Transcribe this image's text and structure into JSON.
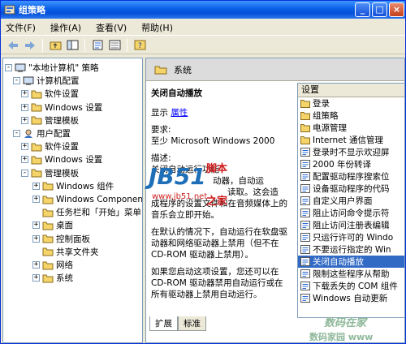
{
  "title": "组策略",
  "menu": [
    "文件(F)",
    "操作(A)",
    "查看(V)",
    "帮助(H)"
  ],
  "tree": [
    {
      "label": "\"本地计算机\" 策略",
      "level": 0,
      "pm": "-",
      "icon": "computer"
    },
    {
      "label": "计算机配置",
      "level": 1,
      "pm": "-",
      "icon": "computer"
    },
    {
      "label": "软件设置",
      "level": 2,
      "pm": "+",
      "icon": "folder"
    },
    {
      "label": "Windows 设置",
      "level": 2,
      "pm": "+",
      "icon": "folder"
    },
    {
      "label": "管理模板",
      "level": 2,
      "pm": "+",
      "icon": "folder"
    },
    {
      "label": "用户配置",
      "level": 1,
      "pm": "-",
      "icon": "user"
    },
    {
      "label": "软件设置",
      "level": 2,
      "pm": "+",
      "icon": "folder"
    },
    {
      "label": "Windows 设置",
      "level": 2,
      "pm": "+",
      "icon": "folder"
    },
    {
      "label": "管理模板",
      "level": 2,
      "pm": "-",
      "icon": "folder"
    },
    {
      "label": "Windows 组件",
      "level": 3,
      "pm": "+",
      "icon": "folder"
    },
    {
      "label": "Windows Components",
      "level": 3,
      "pm": "+",
      "icon": "folder"
    },
    {
      "label": "任务栏和「开始」菜单",
      "level": 3,
      "pm": "",
      "icon": "folder"
    },
    {
      "label": "桌面",
      "level": 3,
      "pm": "+",
      "icon": "folder"
    },
    {
      "label": "控制面板",
      "level": 3,
      "pm": "+",
      "icon": "folder"
    },
    {
      "label": "共享文件夹",
      "level": 3,
      "pm": "",
      "icon": "folder"
    },
    {
      "label": "网络",
      "level": 3,
      "pm": "+",
      "icon": "folder"
    },
    {
      "label": "系统",
      "level": 3,
      "pm": "+",
      "icon": "folder"
    }
  ],
  "right": {
    "header": "系统",
    "setting_title": "关闭自动播放",
    "display_label": "显示",
    "properties_link": "属性",
    "requirements_label": "要求:",
    "requirements": "至少 Microsoft Windows 2000",
    "desc_label": "描述:",
    "desc_lines": [
      "关闭自动运行功能",
      "动器，自动运",
      "读取。这会造",
      "成程序的设置文件和在音频媒体上的音乐会立即开始。"
    ],
    "para2": "在默认的情况下，自动运行在软盘驱动器和网络驱动器上禁用（但不在 CD-ROM 驱动器上禁用）。",
    "para3": "如果您启动这项设置，您还可以在 CD-ROM 驱动器禁用自动运行或在所有驱动器上禁用自动运行。"
  },
  "list": {
    "header": "设置",
    "items": [
      {
        "label": "登录",
        "icon": "folder"
      },
      {
        "label": "组策略",
        "icon": "folder"
      },
      {
        "label": "电源管理",
        "icon": "folder"
      },
      {
        "label": "Internet 通信管理",
        "icon": "folder"
      },
      {
        "label": "登录时不显示欢迎屏",
        "icon": "setting"
      },
      {
        "label": "2000 年份转译",
        "icon": "setting"
      },
      {
        "label": "配置驱动程序搜索位",
        "icon": "setting"
      },
      {
        "label": "设备驱动程序的代码",
        "icon": "setting"
      },
      {
        "label": "自定义用户界面",
        "icon": "setting"
      },
      {
        "label": "阻止访问命令提示符",
        "icon": "setting"
      },
      {
        "label": "阻止访问注册表编辑",
        "icon": "setting"
      },
      {
        "label": "只运行许可的 Windo",
        "icon": "setting"
      },
      {
        "label": "不要运行指定的 Win",
        "icon": "setting"
      },
      {
        "label": "关闭自动播放",
        "icon": "setting",
        "selected": true
      },
      {
        "label": "限制这些程序从帮助",
        "icon": "setting"
      },
      {
        "label": "下载丢失的 COM 组件",
        "icon": "setting"
      },
      {
        "label": "Windows 自动更新",
        "icon": "setting"
      }
    ]
  },
  "tabs": [
    "扩展",
    "标准"
  ],
  "watermark": {
    "a": "JB51",
    "b": "脚本",
    "c": "之家",
    "d": "www.jb51.net",
    "e": "数码在家",
    "f": "数码家园 www"
  }
}
